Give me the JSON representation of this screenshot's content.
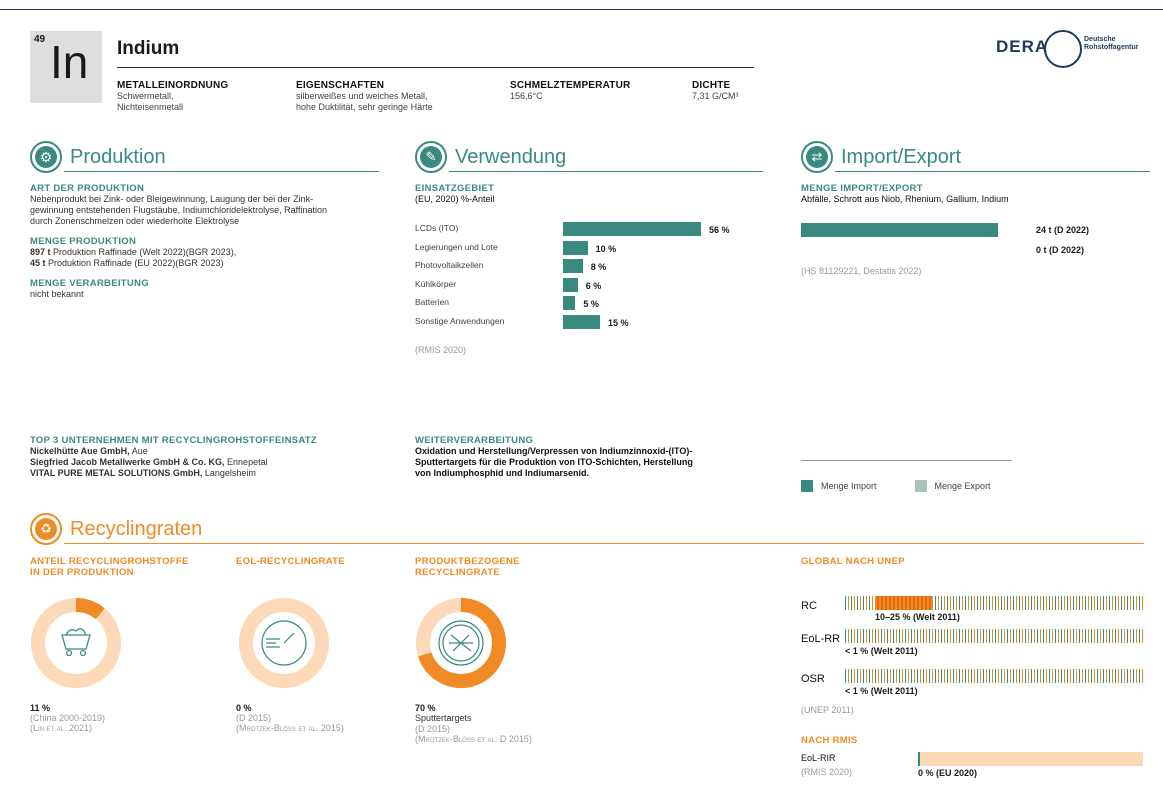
{
  "element": {
    "number": "49",
    "symbol": "In",
    "name": "Indium"
  },
  "properties": [
    {
      "heading": "METALLEINORDNUNG",
      "lines": [
        "Schwermetall,",
        "Nichteisenmetall"
      ]
    },
    {
      "heading": "EIGENSCHAFTEN",
      "lines": [
        "silberweißes und weiches Metall,",
        "hohe Duktilität, sehr geringe Härte"
      ]
    },
    {
      "heading": "SCHMELZTEMPERATUR",
      "lines": [
        "156,6°C"
      ]
    },
    {
      "heading": "DICHTE",
      "lines": [
        "7,31 G/CM³"
      ]
    }
  ],
  "logo": {
    "text": "DERA",
    "line1": "Deutsche",
    "line2": "Rohstoffagentur"
  },
  "produktion": {
    "title": "Produktion",
    "art_label": "ART DER PRODUKTION",
    "art_lines": [
      "Nebenprodukt bei Zink- oder Bleigewinnung, Laugung der bei der Zink-",
      "gewinnung entstehenden Flugstäube, Indiumchloridelektrolyse, Raffination",
      "durch Zonenschmelzen oder wiederholte Elektrolyse"
    ],
    "menge_label": "MENGE PRODUKTION",
    "menge_1_value": "897 t",
    "menge_1_text": " Produktion Raffinade (Welt 2022)(BGR 2023),",
    "menge_2_value": "45 t",
    "menge_2_text": " Produktion Raffinade (EU 2022)(BGR 2023)",
    "verarbeitung_label": "MENGE VERARBEITUNG",
    "verarbeitung_text": "nicht bekannt"
  },
  "verwendung": {
    "title": "Verwendung",
    "label": "EINSATZGEBIET",
    "sublabel": "(EU, 2020) %-Anteil",
    "source": "(RMIS 2020)",
    "chart_data": {
      "type": "bar",
      "categories": [
        "LCDs (ITO)",
        "Legierungen und Lote",
        "Photovoltaikzellen",
        "Kühlkörper",
        "Batterien",
        "Sonstige Anwendungen"
      ],
      "values": [
        56,
        10,
        8,
        6,
        5,
        15
      ],
      "value_labels": [
        "56 %",
        "10 %",
        "8 %",
        "6 %",
        "5 %",
        "15 %"
      ],
      "unit": "%"
    }
  },
  "importexport": {
    "title": "Import/Export",
    "label": "MENGE IMPORT/EXPORT",
    "sublabel": "Abfälle, Schrott aus Niob, Rhenium, Gallium, Indium",
    "import_label": "24 t (D 2022)",
    "export_label": "0 t (D 2022)",
    "import_value": 24,
    "export_value": 0,
    "source": "(HS 81129221, Destatis 2022)",
    "legend_import": "Menge Import",
    "legend_export": "Menge Export",
    "color_import": "#3a8a80",
    "color_export": "#a9c4b8"
  },
  "unternehmen": {
    "label": "TOP 3 UNTERNEHMEN MIT RECYCLINGROHSTOFFEINSATZ",
    "items": [
      {
        "name": "Nickelhütte Aue GmbH,",
        "place": " Aue"
      },
      {
        "name": "Siegfried Jacob Metallwerke GmbH & Co. KG,",
        "place": " Ennepetal"
      },
      {
        "name": "VITAL PURE METAL SOLUTIONS GmbH,",
        "place": " Langelsheim"
      }
    ]
  },
  "weiterverarbeitung": {
    "label": "WEITERVERARBEITUNG",
    "lines": [
      "Oxidation und Herstellung/Verpressen von Indiumzinnoxid-(ITO)-",
      "Sputtertargets für die Produktion von ITO-Schichten, Herstellung",
      "von Indiumphosphid und Indiumarsenid."
    ]
  },
  "recycling": {
    "title": "Recyclingraten",
    "anteil": {
      "label_1": "ANTEIL RECYCLINGROHSTOFFE",
      "label_2": "IN DER PRODUKTION",
      "value": "11 %",
      "fraction": 0.11,
      "src_1": "(China 2000-2019)",
      "src_2": "(Lin et al. 2021)"
    },
    "eol": {
      "label": "EOL-RECYCLINGRATE",
      "value": "0 %",
      "fraction": 0.0,
      "src_1": "(D 2015)",
      "src_2": "(Mrotzek-Blöss et al. 2015)"
    },
    "produkt": {
      "label_1": "PRODUKTBEZOGENE",
      "label_2": "RECYCLINGRATE",
      "value": "70 %",
      "fraction": 0.7,
      "line_1": "Sputtertargets",
      "src_1": "(D 2015)",
      "src_2": "(Mrotzek-Blöss et al. D 2015)"
    },
    "unep": {
      "label": "GLOBAL NACH UNEP",
      "rows": [
        {
          "name": "RC",
          "note": "10–25 % (Welt 2011)"
        },
        {
          "name": "EoL-RR",
          "note": "< 1 % (Welt 2011)"
        },
        {
          "name": "OSR",
          "note": "< 1 % (Welt 2011)"
        }
      ],
      "source": "(UNEP 2011)"
    },
    "rmis": {
      "label": "NACH RMIS",
      "name": "EoL-RIR",
      "source": "(RMIS 2020)",
      "value": "0 % (EU 2020)",
      "fraction": 0.0
    },
    "color_orange": "#f08a24",
    "color_light": "#fcd9b8"
  }
}
